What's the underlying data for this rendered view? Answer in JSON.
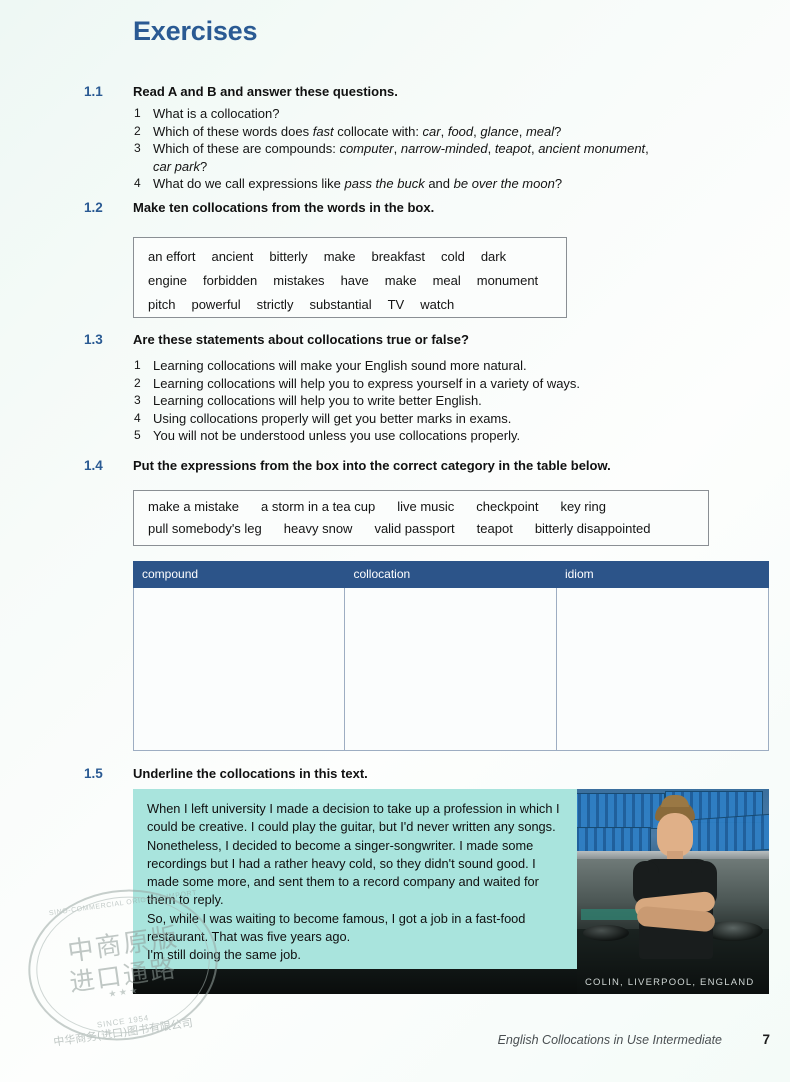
{
  "page": {
    "title": "Exercises",
    "footer_title": "English Collocations in Use Intermediate",
    "page_number": "7",
    "accent_color": "#2a5a93",
    "table_header_color": "#2c5489",
    "panel_color": "#a9e4dd"
  },
  "ex11": {
    "number": "1.1",
    "instruction": "Read A and B and answer these questions.",
    "questions": [
      "What is a collocation?",
      "Which of these words does fast collocate with: car, food, glance, meal?",
      "Which of these are compounds: computer, narrow-minded, teapot, ancient monument, car park?",
      "What do we call expressions like pass the buck and be over the moon?"
    ]
  },
  "ex12": {
    "number": "1.2",
    "instruction": "Make ten collocations from the words in the box.",
    "word_rows": [
      [
        "an effort",
        "ancient",
        "bitterly",
        "make",
        "breakfast",
        "cold",
        "dark"
      ],
      [
        "engine",
        "forbidden",
        "mistakes",
        "have",
        "make",
        "meal",
        "monument"
      ],
      [
        "pitch",
        "powerful",
        "strictly",
        "substantial",
        "TV",
        "watch"
      ]
    ]
  },
  "ex13": {
    "number": "1.3",
    "instruction": "Are these statements about collocations true or false?",
    "statements": [
      "Learning collocations will make your English sound more natural.",
      "Learning collocations will help you to express yourself in a variety of ways.",
      "Learning collocations will help you to write better English.",
      "Using collocations properly will get you better marks in exams.",
      "You will not be understood unless you use collocations properly."
    ]
  },
  "ex14": {
    "number": "1.4",
    "instruction": "Put the expressions from the box into the correct category in the table below.",
    "expression_rows": [
      [
        "make a mistake",
        "a storm in a tea cup",
        "live music",
        "checkpoint",
        "key ring"
      ],
      [
        "pull somebody's leg",
        "heavy snow",
        "valid passport",
        "teapot",
        "bitterly disappointed"
      ]
    ],
    "table_headers": [
      "compound",
      "collocation",
      "idiom"
    ],
    "table_rows": [
      [
        "",
        "",
        ""
      ]
    ]
  },
  "ex15": {
    "number": "1.5",
    "instruction": "Underline the collocations in this text.",
    "story_paragraphs": [
      "When I left university I made a decision to take up a profession in which I could be creative. I could play the guitar, but I'd never written any songs. Nonetheless, I decided to become a singer-songwriter. I made some recordings but I had a rather heavy cold, so they didn't sound good. I made some more, and sent them to a record company and waited for them to reply.",
      "So, while I was waiting to become famous, I got a job in a fast-food restaurant. That was five years ago.",
      "I'm still doing the same job."
    ],
    "photo_caption": "COLIN, LIVERPOOL, ENGLAND"
  },
  "watermark": {
    "arc_top": "SINO-COMMERCIAL ORIGINAL IMPORT",
    "arc_bottom": "SINCE 1954",
    "chinese_line1": "中商原版",
    "chinese_line2": "进口通路",
    "chinese_line3": "中华商务(进口)图书有限公司",
    "stars": "★ ★ ★"
  }
}
